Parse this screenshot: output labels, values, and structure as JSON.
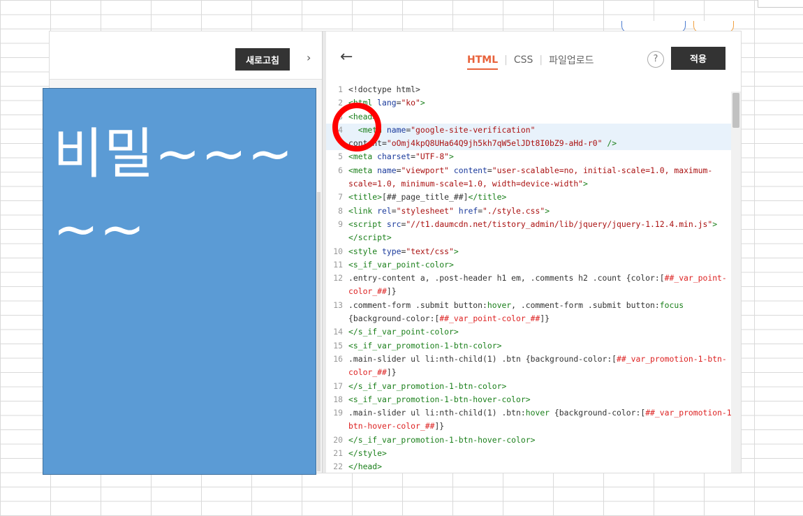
{
  "left": {
    "refresh_label": "새로고침",
    "collapse_icon": "›"
  },
  "editor": {
    "back_icon": "←",
    "tabs": [
      "HTML",
      "CSS",
      "파일업로드"
    ],
    "help_label": "?",
    "apply_label": "적용"
  },
  "code_lines": [
    {
      "n": "1",
      "html": "&lt;!doctype html&gt;"
    },
    {
      "n": "2",
      "html": "<span class='tag'>&lt;html</span> <span class='attr'>lang</span>=<span class='str'>\"ko\"</span><span class='tag'>&gt;</span>"
    },
    {
      "n": "3",
      "html": "<span class='tag'>&lt;head&gt;</span>"
    },
    {
      "n": "4",
      "html": "  <span class='tag'>&lt;meta</span> <span class='attr'>name</span>=<span class='str'>\"google-site-verification\"</span>",
      "hl": true
    },
    {
      "n": "",
      "html": "content=<span class='str'>\"oOmj4kpQ8UHa64Q9jh5kh7qW5elJDt8I0bZ9-aHd-r0\"</span> <span class='tag'>/&gt;</span>",
      "hl": true
    },
    {
      "n": "5",
      "html": "<span class='tag'>&lt;meta</span> <span class='attr'>charset</span>=<span class='str'>\"UTF-8\"</span><span class='tag'>&gt;</span>"
    },
    {
      "n": "6",
      "html": "<span class='tag'>&lt;meta</span> <span class='attr'>name</span>=<span class='str'>\"viewport\"</span> <span class='attr'>content</span>=<span class='str'>\"user-scalable=no, initial-scale=1.0, maximum-</span>"
    },
    {
      "n": "",
      "html": "<span class='str'>scale=1.0, minimum-scale=1.0, width=device-width\"</span><span class='tag'>&gt;</span>"
    },
    {
      "n": "7",
      "html": "<span class='tag'>&lt;title&gt;</span>[##_page_title_##]<span class='tag'>&lt;/title&gt;</span>"
    },
    {
      "n": "8",
      "html": "<span class='tag'>&lt;link</span> <span class='attr'>rel</span>=<span class='str'>\"stylesheet\"</span> <span class='attr'>href</span>=<span class='str'>\"./style.css\"</span><span class='tag'>&gt;</span>"
    },
    {
      "n": "9",
      "html": "<span class='tag'>&lt;script</span> <span class='attr'>src</span>=<span class='str'>\"//t1.daumcdn.net/tistory_admin/lib/jquery/jquery-1.12.4.min.js\"</span><span class='tag'>&gt;</span>"
    },
    {
      "n": "",
      "html": "<span class='tag'>&lt;/script&gt;</span>"
    },
    {
      "n": "10",
      "html": "<span class='tag'>&lt;style</span> <span class='attr'>type</span>=<span class='str'>\"text/css\"</span><span class='tag'>&gt;</span>"
    },
    {
      "n": "11",
      "html": "<span class='tag'>&lt;s_if_var_point-color&gt;</span>"
    },
    {
      "n": "12",
      "html": ".entry-content a, .post-header h1 em, .comments h2 .count {color:[<span class='var'>##_var_point-</span>"
    },
    {
      "n": "",
      "html": "<span class='var'>color_##</span>]}"
    },
    {
      "n": "13",
      "html": ".comment-form .submit button:<span class='tag'>hover</span>, .comment-form .submit button:<span class='tag'>focus</span>"
    },
    {
      "n": "",
      "html": "{background-color:[<span class='var'>##_var_point-color_##</span>]}"
    },
    {
      "n": "14",
      "html": "<span class='tag'>&lt;/s_if_var_point-color&gt;</span>"
    },
    {
      "n": "15",
      "html": "<span class='tag'>&lt;s_if_var_promotion-1-btn-color&gt;</span>"
    },
    {
      "n": "16",
      "html": ".main-slider ul li:nth-child(1) .btn {background-color:[<span class='var'>##_var_promotion-1-btn-</span>"
    },
    {
      "n": "",
      "html": "<span class='var'>color_##</span>]}"
    },
    {
      "n": "17",
      "html": "<span class='tag'>&lt;/s_if_var_promotion-1-btn-color&gt;</span>"
    },
    {
      "n": "18",
      "html": "<span class='tag'>&lt;s_if_var_promotion-1-btn-hover-color&gt;</span>"
    },
    {
      "n": "19",
      "html": ".main-slider ul li:nth-child(1) .btn:<span class='tag'>hover</span> {background-color:[<span class='var'>##_var_promotion-1-</span>"
    },
    {
      "n": "",
      "html": "<span class='var'>btn-hover-color_##</span>]}"
    },
    {
      "n": "20",
      "html": "<span class='tag'>&lt;/s_if_var_promotion-1-btn-hover-color&gt;</span>"
    },
    {
      "n": "21",
      "html": "<span class='tag'>&lt;/style&gt;</span>"
    },
    {
      "n": "22",
      "html": "<span class='tag'>&lt;/head&gt;</span>"
    }
  ],
  "overlay": {
    "text_line1": "비밀~~~",
    "text_line2": "~~"
  },
  "colors": {
    "accent": "#e8623b",
    "overlay_blue": "#5b9bd5",
    "circle_red": "#ff0000"
  }
}
